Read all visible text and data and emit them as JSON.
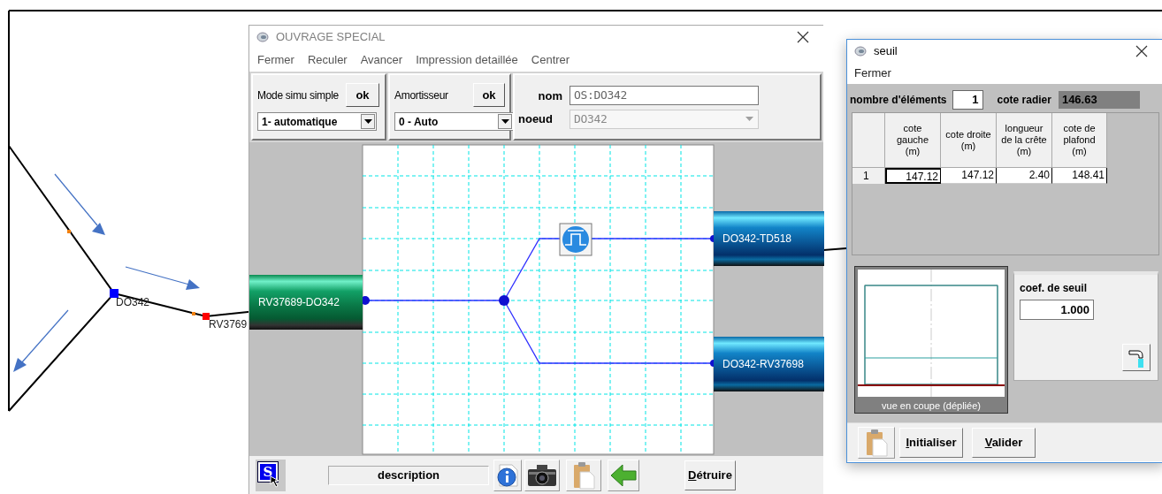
{
  "map": {
    "labels": [
      {
        "text": "DO342"
      },
      {
        "text": "RV3769"
      }
    ]
  },
  "ouvrage_window": {
    "title": "OUVRAGE SPECIAL",
    "menu": [
      "Fermer",
      "Reculer",
      "Avancer",
      "Impression detaillée",
      "Centrer"
    ],
    "mode_simu": {
      "label": "Mode simu simple",
      "button": "ok",
      "value": "1- automatique"
    },
    "amortisseur": {
      "label": "Amortisseur",
      "button": "ok",
      "value": "0 - Auto"
    },
    "nom": {
      "label": "nom",
      "value": "OS:DO342"
    },
    "noeud": {
      "label": "noeud",
      "value": "DO342",
      "disabled": true
    },
    "pipes": [
      {
        "label": "RV37689-DO342",
        "kind": "inlet"
      },
      {
        "label": "DO342-TD518",
        "kind": "outlet"
      },
      {
        "label": "DO342-RV37698",
        "kind": "outlet"
      }
    ],
    "tool_badge": "S",
    "description": "description",
    "destroy_button": "Détruire"
  },
  "seuil_window": {
    "title": "seuil",
    "menu": [
      "Fermer"
    ],
    "element_count": {
      "label": "nombre d'éléments",
      "value": "1"
    },
    "cote_radier": {
      "label": "cote radier",
      "value": "146.63"
    },
    "table": {
      "columns": [
        "cote\ngauche\n(m)",
        "cote droite\n(m)",
        "longueur\nde la crête\n(m)",
        "cote de\nplafond\n(m)"
      ],
      "rows": [
        {
          "index": "1",
          "cells": [
            "147.12",
            "147.12",
            "2.40",
            "148.41"
          ]
        }
      ]
    },
    "section_caption": "vue en coupe (dépliée)",
    "coef": {
      "label": "coef. de seuil",
      "value": "1.000"
    },
    "buttons": [
      "Initialiser",
      "Valider"
    ]
  }
}
